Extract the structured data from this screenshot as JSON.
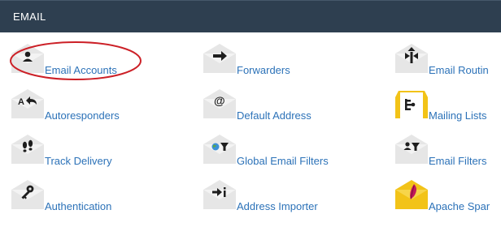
{
  "section": {
    "title": "EMAIL"
  },
  "items": [
    {
      "label": "Email Accounts",
      "icon": "user-icon"
    },
    {
      "label": "Forwarders",
      "icon": "arrow-right-icon"
    },
    {
      "label": "Email Routin",
      "icon": "routing-icon"
    },
    {
      "label": "Autoresponders",
      "icon": "autoresponder-icon"
    },
    {
      "label": "Default Address",
      "icon": "at-sign-icon"
    },
    {
      "label": "Mailing Lists",
      "icon": "mailing-list-icon"
    },
    {
      "label": "Track Delivery",
      "icon": "footprints-icon"
    },
    {
      "label": "Global Email Filters",
      "icon": "global-filter-icon"
    },
    {
      "label": "Email Filters",
      "icon": "user-filter-icon"
    },
    {
      "label": "Authentication",
      "icon": "key-icon"
    },
    {
      "label": "Address Importer",
      "icon": "import-icon"
    },
    {
      "label": "Apache Spar",
      "icon": "feather-icon"
    }
  ],
  "colors": {
    "header_bg": "#2e3f50",
    "link": "#2c72b8",
    "envelope": "#e6e6e6",
    "envelope_yellow": "#f2c318",
    "annotation": "#cc2027"
  }
}
